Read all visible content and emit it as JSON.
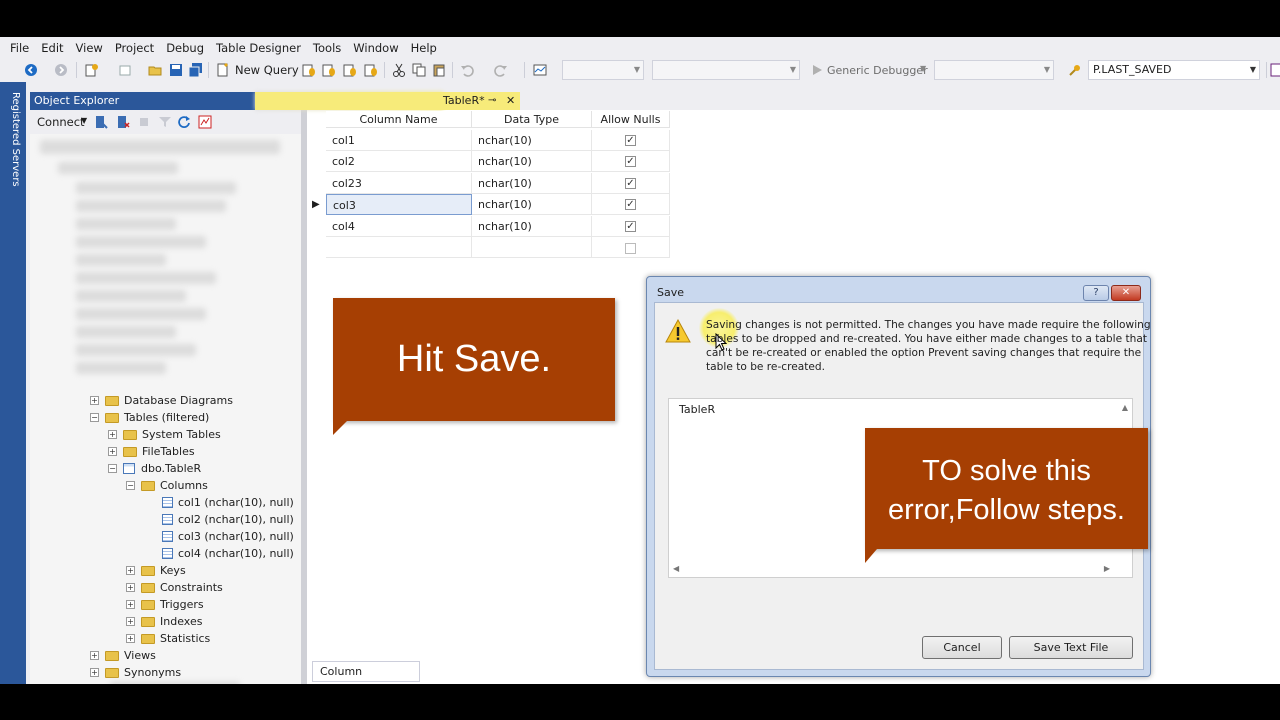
{
  "menu": [
    "File",
    "Edit",
    "View",
    "Project",
    "Debug",
    "Table Designer",
    "Tools",
    "Window",
    "Help"
  ],
  "toolbar": {
    "new_query_label": "New Query",
    "debugger_label": "Generic Debugger",
    "saved_combo_value": "P.LAST_SAVED"
  },
  "rail": {
    "label": "Registered Servers"
  },
  "object_explorer": {
    "title": "Object Explorer",
    "connect_label": "Connect",
    "tree": [
      {
        "label": "Database Diagrams",
        "icon": "folder",
        "expander": "+"
      },
      {
        "label": "Tables (filtered)",
        "icon": "folder",
        "expander": "−"
      },
      {
        "label": "System Tables",
        "icon": "folder",
        "expander": "+"
      },
      {
        "label": "FileTables",
        "icon": "folder",
        "expander": "+"
      },
      {
        "label": "dbo.TableR",
        "icon": "table",
        "expander": "−"
      },
      {
        "label": "Columns",
        "icon": "folder",
        "expander": "−"
      },
      {
        "label": "col1 (nchar(10), null)",
        "icon": "column",
        "expander": ""
      },
      {
        "label": "col2 (nchar(10), null)",
        "icon": "column",
        "expander": ""
      },
      {
        "label": "col3 (nchar(10), null)",
        "icon": "column",
        "expander": ""
      },
      {
        "label": "col4 (nchar(10), null)",
        "icon": "column",
        "expander": ""
      },
      {
        "label": "Keys",
        "icon": "folder",
        "expander": "+"
      },
      {
        "label": "Constraints",
        "icon": "folder",
        "expander": "+"
      },
      {
        "label": "Triggers",
        "icon": "folder",
        "expander": "+"
      },
      {
        "label": "Indexes",
        "icon": "folder",
        "expander": "+"
      },
      {
        "label": "Statistics",
        "icon": "folder",
        "expander": "+"
      },
      {
        "label": "Views",
        "icon": "folder",
        "expander": "+"
      },
      {
        "label": "Synonyms",
        "icon": "folder",
        "expander": "+"
      }
    ]
  },
  "document": {
    "tab_label": "TableR*",
    "pin_glyph": "⊸",
    "close_glyph": "✕",
    "grid": {
      "headers": [
        "Column Name",
        "Data Type",
        "Allow Nulls"
      ],
      "rows": [
        {
          "name": "col1",
          "type": "nchar(10)",
          "allow_nulls": true
        },
        {
          "name": "col2",
          "type": "nchar(10)",
          "allow_nulls": true
        },
        {
          "name": "col23",
          "type": "nchar(10)",
          "allow_nulls": true
        },
        {
          "name": "col3",
          "type": "nchar(10)",
          "allow_nulls": true
        },
        {
          "name": "col4",
          "type": "nchar(10)",
          "allow_nulls": true
        },
        {
          "name": "",
          "type": "",
          "allow_nulls": false
        }
      ],
      "selected_row": 3
    },
    "bottom_tab": "Column Properties"
  },
  "callouts": {
    "hit_save": "Hit Save.",
    "solve_line1": "TO solve this",
    "solve_line2": "error,Follow steps."
  },
  "dialog": {
    "title": "Save",
    "help_glyph": "?",
    "close_glyph": "✕",
    "message_line1": "Saving changes is not permitted. The changes you have made require the following",
    "message_line2": "tables to be dropped and re-created. You have either made changes to a table that",
    "message_line3": "can't be re-created or enabled the option Prevent saving changes that require the",
    "message_line4": "table to be re-created.",
    "list_item": "TableR",
    "cancel_label": "Cancel",
    "save_text_label": "Save Text File"
  },
  "colors": {
    "accent_blue": "#2b579a",
    "callout_orange": "#a63f03",
    "tab_yellow": "#f7eb7a"
  }
}
